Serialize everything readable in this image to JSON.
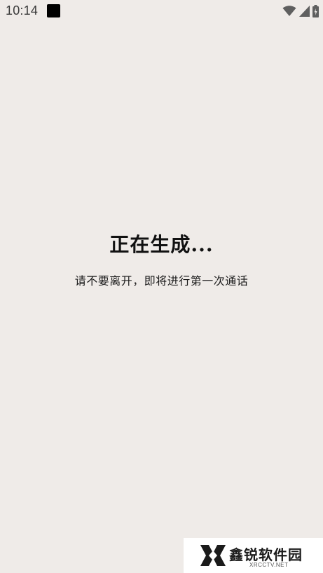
{
  "status_bar": {
    "time": "10:14",
    "icons": [
      "notification-square-icon",
      "wifi-icon",
      "signal-icon",
      "battery-icon"
    ]
  },
  "main": {
    "title": "正在生成...",
    "subtitle": "请不要离开，即将进行第一次通话"
  },
  "watermark": {
    "brand": "鑫锐软件园",
    "url": "XRCCTV.NET"
  },
  "colors": {
    "background": "#efebe8",
    "text": "#111111",
    "status_icons": "#5f5f5f"
  }
}
